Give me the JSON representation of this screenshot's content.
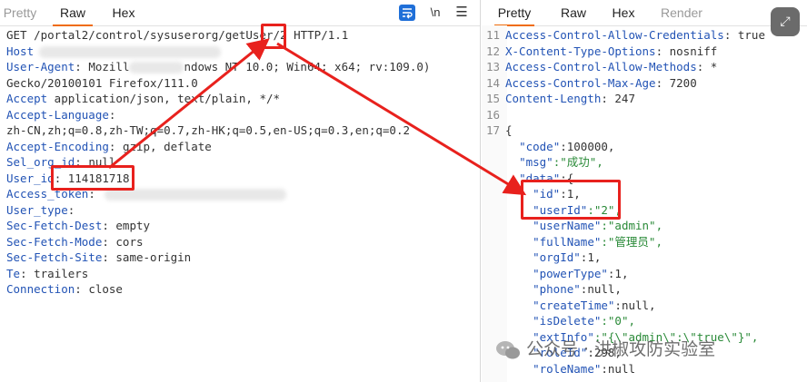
{
  "left": {
    "tabs": [
      "Pretty",
      "Raw",
      "Hex"
    ],
    "active_tab": "Raw",
    "toolbar": {
      "wrap_icon": "wrap-lines-icon",
      "newline_label": "\\n",
      "menu_icon": "menu-icon"
    },
    "request": {
      "request_line_prefix": "GET /portal2/control/sysuserorg/getUser/",
      "request_line_id": "2",
      "request_line_suffix": " HTTP/1.1",
      "host_key": "Host",
      "ua_key": "User-Agent",
      "ua_visible": "ndows NT 10.0; Win64; x64; rv:109.0)",
      "gecko": "Gecko/20100101 Firefox/111.0",
      "headers": [
        {
          "k": "Accept",
          "v": " application/json, text/plain, */*"
        },
        {
          "k": "Accept-Language",
          "v": ":"
        },
        {
          "k": "",
          "v": "zh-CN,zh;q=0.8,zh-TW;q=0.7,zh-HK;q=0.5,en-US;q=0.3,en;q=0.2"
        },
        {
          "k": "Accept-Encoding",
          "v": ": gzip, deflate"
        },
        {
          "k": "Sel_org_id",
          "v": ": null"
        },
        {
          "k": "User_id",
          "v": ": 114181718"
        },
        {
          "k": "Access_token",
          "v": ":"
        },
        {
          "k": "User_type",
          "v": ":"
        },
        {
          "k": "Sec-Fetch-Dest",
          "v": ": empty"
        },
        {
          "k": "Sec-Fetch-Mode",
          "v": ": cors"
        },
        {
          "k": "Sec-Fetch-Site",
          "v": ": same-origin"
        },
        {
          "k": "Te",
          "v": ": trailers"
        },
        {
          "k": "Connection",
          "v": ": close"
        }
      ]
    }
  },
  "right": {
    "tabs": [
      "Pretty",
      "Raw",
      "Hex",
      "Render"
    ],
    "active_tab": "Pretty",
    "expand_icon": "expand-icon",
    "response_lines": [
      {
        "n": "11",
        "k": "Access-Control-Allow-Credentials",
        "v": ": true"
      },
      {
        "n": "12",
        "k": "X-Content-Type-Options",
        "v": ": nosniff"
      },
      {
        "n": "13",
        "k": "Access-Control-Allow-Methods",
        "v": ": *"
      },
      {
        "n": "14",
        "k": "Access-Control-Max-Age",
        "v": ": 7200"
      },
      {
        "n": "15",
        "k": "Content-Length",
        "v": ": 247"
      },
      {
        "n": "16",
        "k": "",
        "v": ""
      },
      {
        "n": "17",
        "k": "",
        "v": "{"
      }
    ],
    "json_lines": [
      {
        "k": "\"code\"",
        "v": ":100000,",
        "indent": 1
      },
      {
        "k": "\"msg\"",
        "v": ":\"成功\",",
        "indent": 1
      },
      {
        "k": "\"data\"",
        "v": ":{",
        "indent": 1
      },
      {
        "k": "\"id\"",
        "v": ":1,",
        "indent": 2
      },
      {
        "k": "\"userId\"",
        "v": ":\"2\",",
        "indent": 2
      },
      {
        "k": "\"userName\"",
        "v": ":\"admin\",",
        "indent": 2
      },
      {
        "k": "\"fullName\"",
        "v": ":\"管理员\",",
        "indent": 2
      },
      {
        "k": "\"orgId\"",
        "v": ":1,",
        "indent": 2
      },
      {
        "k": "\"powerType\"",
        "v": ":1,",
        "indent": 2
      },
      {
        "k": "\"phone\"",
        "v": ":null,",
        "indent": 2
      },
      {
        "k": "\"createTime\"",
        "v": ":null,",
        "indent": 2
      },
      {
        "k": "\"isDelete\"",
        "v": ":\"0\",",
        "indent": 2
      },
      {
        "k": "\"extInfo\"",
        "v": ":\"{\\\"admin\\\":\\\"true\\\"}\",",
        "indent": 2
      },
      {
        "k": "\"roleId\"",
        "v": ":298,",
        "indent": 2
      },
      {
        "k": "\"roleName\"",
        "v": ":null",
        "indent": 2
      }
    ]
  },
  "watermark": {
    "text": "公众号 · 洪椒攻防实验室",
    "icon": "wechat-icon"
  },
  "colors": {
    "accent": "#ef6c0c",
    "annotation": "#e8211d",
    "link_blue": "#1f6fd8"
  }
}
